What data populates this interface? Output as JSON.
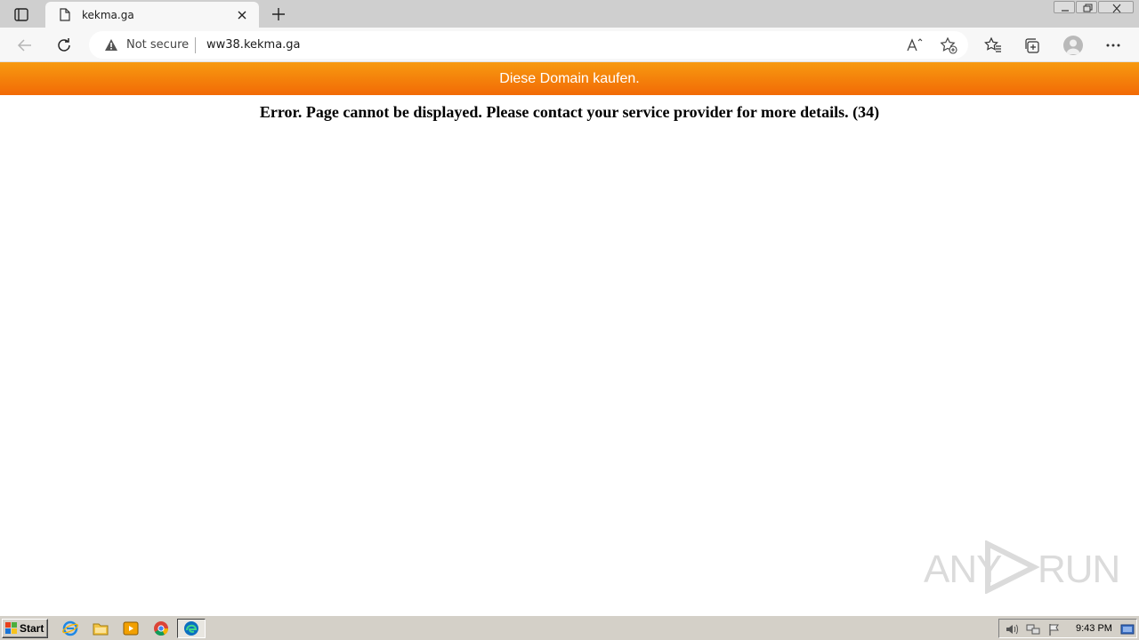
{
  "browser": {
    "tab": {
      "title": "kekma.ga"
    },
    "address_bar": {
      "security_label": "Not secure",
      "url": "ww38.kekma.ga"
    }
  },
  "page": {
    "banner_text": "Diese Domain kaufen.",
    "error_message": "Error. Page cannot be displayed. Please contact your service provider for more details. (34)"
  },
  "taskbar": {
    "start_label": "Start",
    "clock": "9:43 PM"
  },
  "colors": {
    "banner": "#f47f0a",
    "taskbar": "#d4d0c8"
  }
}
